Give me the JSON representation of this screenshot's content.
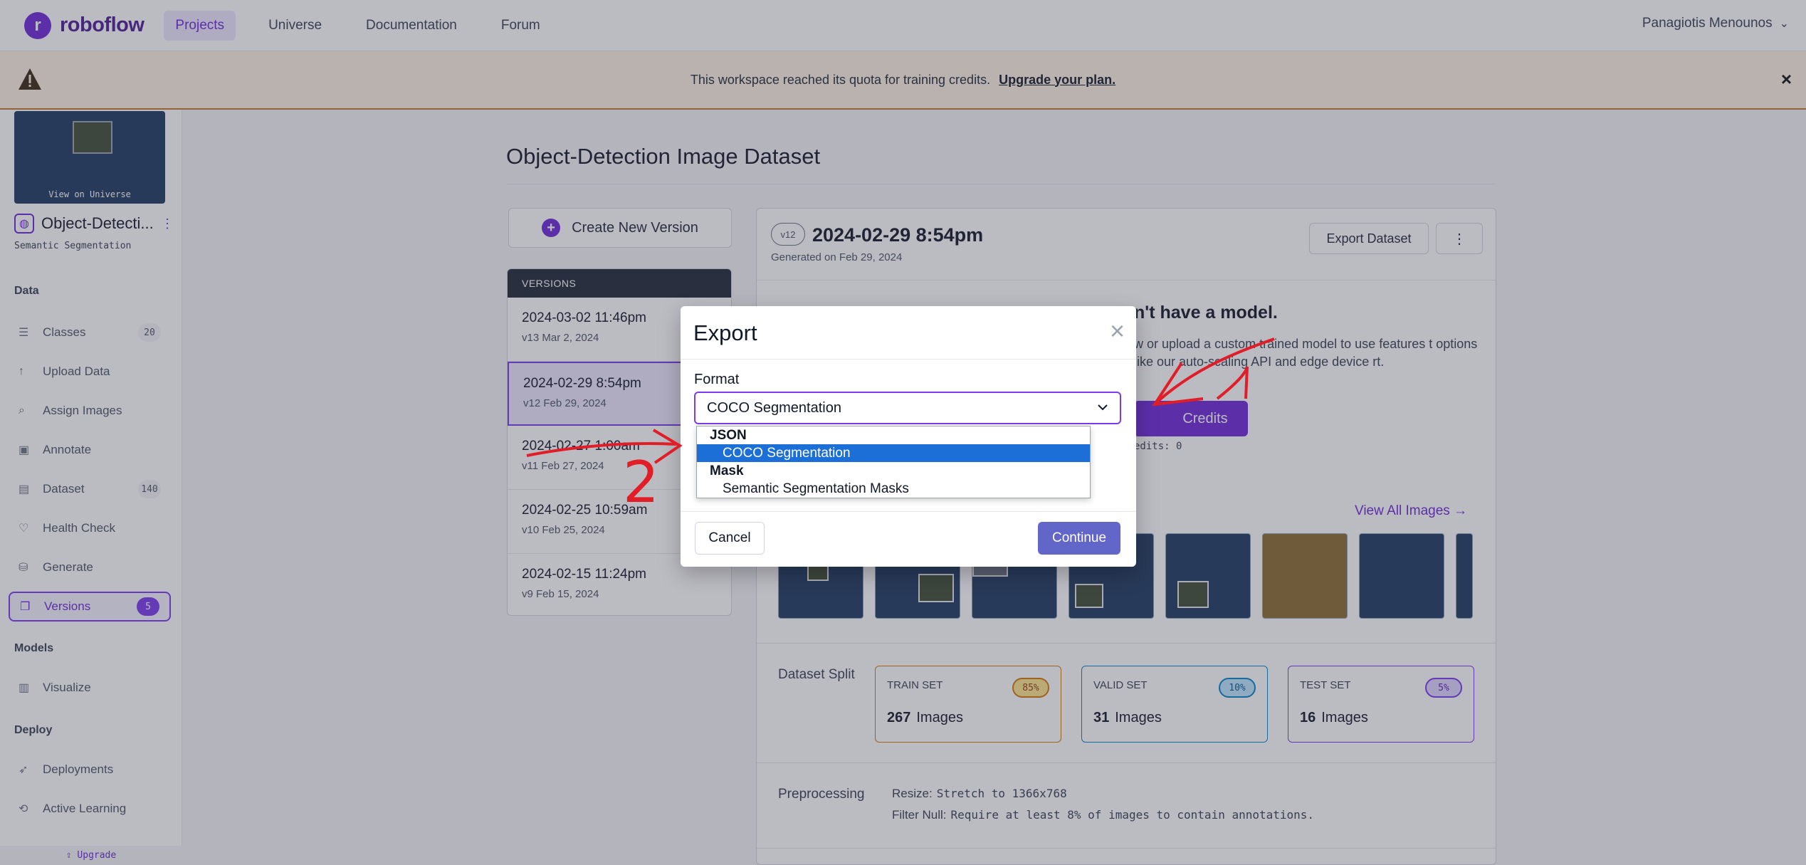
{
  "brand": {
    "name": "roboflow",
    "logo_icon": "roboflow-logo-icon"
  },
  "nav": {
    "links": [
      {
        "label": "Projects",
        "active": true
      },
      {
        "label": "Universe",
        "active": false
      },
      {
        "label": "Documentation",
        "active": false
      },
      {
        "label": "Forum",
        "active": false
      }
    ],
    "user": "Panagiotis Menounos"
  },
  "banner": {
    "message": "This workspace reached its quota for training credits.",
    "link": "Upgrade your plan.",
    "close": "×",
    "bg_color": "#fdf1e1"
  },
  "sidebar": {
    "thumbnail_caption": "View on Universe",
    "project_name": "Object-Detecti...",
    "project_type": "Semantic Segmentation",
    "sections": {
      "data": "Data",
      "models": "Models",
      "deploy": "Deploy"
    },
    "items": [
      {
        "label": "Classes",
        "icon": "list-icon",
        "count": "20"
      },
      {
        "label": "Upload Data",
        "icon": "upload-icon",
        "count": ""
      },
      {
        "label": "Assign Images",
        "icon": "search-icon",
        "count": ""
      },
      {
        "label": "Annotate",
        "icon": "annotate-icon",
        "count": ""
      },
      {
        "label": "Dataset",
        "icon": "dataset-icon",
        "count": "140"
      },
      {
        "label": "Health Check",
        "icon": "heart-icon",
        "count": ""
      },
      {
        "label": "Generate",
        "icon": "generate-icon",
        "count": ""
      },
      {
        "label": "Versions",
        "icon": "versions-icon",
        "count": "5",
        "active": true
      },
      {
        "label": "Visualize",
        "icon": "chart-icon",
        "count": ""
      },
      {
        "label": "Deployments",
        "icon": "rocket-icon",
        "count": ""
      },
      {
        "label": "Active Learning",
        "icon": "active-learning-icon",
        "count": ""
      }
    ],
    "upgrade": "Upgrade"
  },
  "main": {
    "title": "Object-Detection Image Dataset",
    "create_version": "Create New Version",
    "versions_header": "VERSIONS",
    "versions": [
      {
        "title": "2024-03-02 11:46pm",
        "sub": "v13 Mar 2, 2024"
      },
      {
        "title": "2024-02-29 8:54pm",
        "sub": "v12 Feb 29, 2024",
        "selected": true
      },
      {
        "title": "2024-02-27 1:00am",
        "sub": "v11 Feb 27, 2024"
      },
      {
        "title": "2024-02-25 10:59am",
        "sub": "v10 Feb 25, 2024"
      },
      {
        "title": "2024-02-15 11:24pm",
        "sub": "v9 Feb 15, 2024"
      }
    ]
  },
  "panel": {
    "badge": "v12",
    "title": "2024-02-29 8:54pm",
    "generated": "Generated on Feb 29, 2024",
    "export_button": "Export Dataset",
    "more_button": "⋮",
    "no_model_heading": "n't have a model.",
    "no_model_text": "w or upload a custom trained model to use features t options like our auto-scaling API and edge device rt.",
    "credits_button": "Credits",
    "credits_text": "edits: 0",
    "view_all": "View All Images →",
    "split_label": "Dataset Split",
    "splits": [
      {
        "name": "TRAIN SET",
        "pct": "85%",
        "count": "267",
        "unit": "Images",
        "color": "#d97706",
        "bg": "#fde68a"
      },
      {
        "name": "VALID SET",
        "pct": "10%",
        "count": "31",
        "unit": "Images",
        "color": "#0284c7",
        "bg": "#bae6fd"
      },
      {
        "name": "TEST SET",
        "pct": "5%",
        "count": "16",
        "unit": "Images",
        "color": "#7c3aed",
        "bg": "#ddd6fe"
      }
    ],
    "preprocessing_label": "Preprocessing",
    "preprocessing": [
      {
        "key": "Resize:",
        "value": "Stretch to 1366x768"
      },
      {
        "key": "Filter Null:",
        "value": "Require at least 8% of images to contain annotations."
      }
    ]
  },
  "modal": {
    "title": "Export",
    "close": "×",
    "format_label": "Format",
    "selected_format": "COCO Segmentation",
    "groups": [
      {
        "label": "JSON",
        "options": [
          {
            "label": "COCO Segmentation",
            "highlighted": true
          }
        ]
      },
      {
        "label": "Mask",
        "options": [
          {
            "label": "Semantic Segmentation Masks",
            "highlighted": false
          }
        ]
      }
    ],
    "cancel": "Cancel",
    "continue": "Continue"
  },
  "annotations": {
    "color": "#e11d28",
    "number_label": "2"
  }
}
